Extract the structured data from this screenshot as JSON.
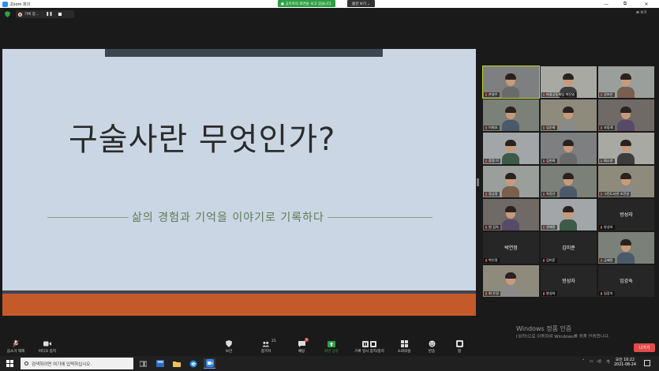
{
  "window": {
    "title": "Zoom 회의",
    "share_banner": "● 공유자의 화면을 보고 있습니다.",
    "view_options": "옵션 보기 ⌄",
    "minimize": "—",
    "maximize": "⧉",
    "close": "✕"
  },
  "recording": {
    "label": "기록 중...",
    "pause": "❚❚"
  },
  "gallery_toggle": "⊞ 보기",
  "slide": {
    "title": "구술사란 무엇인가?",
    "subtitle": "삶의 경험과 기억을 이야기로 기록하다"
  },
  "participants": [
    {
      "label": "손영수",
      "type": "video",
      "active": true
    },
    {
      "label": "마을공동체팀 박진영",
      "type": "video"
    },
    {
      "label": "강보은",
      "type": "video"
    },
    {
      "label": "이희조",
      "type": "video"
    },
    {
      "label": "임순희",
      "type": "video"
    },
    {
      "label": "조동례",
      "type": "video"
    },
    {
      "label": "장경 이",
      "type": "video"
    },
    {
      "label": "김현희",
      "type": "video"
    },
    {
      "label": "최소연",
      "type": "video"
    },
    {
      "label": "장금정",
      "type": "video"
    },
    {
      "label": "차정선",
      "type": "video"
    },
    {
      "label": "그린도서관 조진영",
      "type": "video"
    },
    {
      "label": "원 김숙",
      "type": "video"
    },
    {
      "label": "권혜정",
      "type": "video"
    },
    {
      "label": "방성자",
      "type": "name",
      "name": "방성자"
    },
    {
      "label": "박인정",
      "type": "name",
      "name": "박연정"
    },
    {
      "label": "김미준",
      "type": "name",
      "name": "김미준"
    },
    {
      "label": "금혜정",
      "type": "video"
    },
    {
      "label": "최 은경",
      "type": "video"
    },
    {
      "label": "방성자",
      "type": "name",
      "name": "방성자"
    },
    {
      "label": "임강숙",
      "type": "name",
      "name": "임강숙"
    }
  ],
  "watermark": {
    "line1": "Windows 정품 인증",
    "line2": "[설정]으로 이동하여 Windows를 정품 인증합니다."
  },
  "toolbar": {
    "mute": "음소거 해제",
    "video": "비디오 중지",
    "security": "보안",
    "participants": "참가자",
    "participants_count": "21",
    "chat": "채팅",
    "chat_badge": "1",
    "share": "화면 공유",
    "record": "기록 일시 중지/중지",
    "breakout": "소회의실",
    "reactions": "반응",
    "apps": "앱",
    "leave": "나가기"
  },
  "taskbar": {
    "search_placeholder": "검색하려면 여기에 입력하십시오.",
    "ime": "가",
    "time": "오전 10:22",
    "date": "2021-08-24"
  }
}
